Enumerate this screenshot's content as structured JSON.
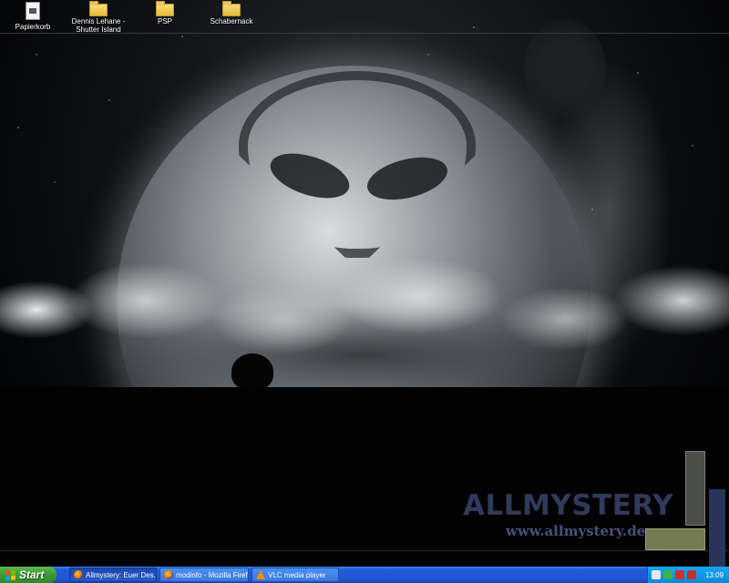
{
  "desktop": {
    "icons": [
      {
        "label": "Papierkorb",
        "icon": "recycle-bin-icon"
      },
      {
        "label": "Dennis Lehane - Shutter Island",
        "icon": "folder-icon"
      },
      {
        "label": "PSP",
        "icon": "folder-icon"
      },
      {
        "label": "Schabernack",
        "icon": "folder-icon"
      }
    ]
  },
  "wallpaper": {
    "brand": "ALLMYSTERY",
    "url": "www.allmystery.de",
    "colors": {
      "brand": "#2f3a5c",
      "accent_olive": "#747a52",
      "accent_navy": "#2a3359"
    }
  },
  "taskbar": {
    "start_label": "Start",
    "tasks": [
      {
        "label": "Allmystery: Euer Des...",
        "icon": "firefox-icon",
        "active": true
      },
      {
        "label": "modinfo - Mozilla Firefox",
        "icon": "firefox-icon",
        "active": false
      },
      {
        "label": "VLC media player",
        "icon": "vlc-icon",
        "active": false
      }
    ],
    "tray": {
      "clock": "13:09",
      "icons": [
        "shield-icon",
        "network-icon",
        "antivirus-icon",
        "security-icon"
      ]
    },
    "colors": {
      "bar": "#245edb",
      "start": "#3c9a36",
      "tray": "#0c8ad8"
    }
  }
}
